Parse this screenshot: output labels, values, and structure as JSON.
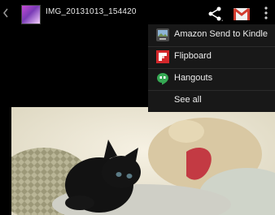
{
  "app_bar": {
    "title": "IMG_20131013_154420",
    "actions": [
      {
        "name": "share",
        "icon": "share-icon"
      },
      {
        "name": "gmail",
        "icon": "gmail-icon"
      },
      {
        "name": "overflow",
        "icon": "overflow-menu-icon"
      }
    ]
  },
  "share_menu": {
    "items": [
      {
        "label": "Amazon Send to Kindle",
        "icon": "kindle-icon"
      },
      {
        "label": "Flipboard",
        "icon": "flipboard-icon"
      },
      {
        "label": "Hangouts",
        "icon": "hangouts-icon"
      },
      {
        "label": "See all",
        "icon": ""
      }
    ]
  },
  "colors": {
    "app_bar_bg": "#000000",
    "menu_bg": "#181818",
    "flipboard_red": "#d3272b",
    "hangouts_green": "#35a853"
  }
}
